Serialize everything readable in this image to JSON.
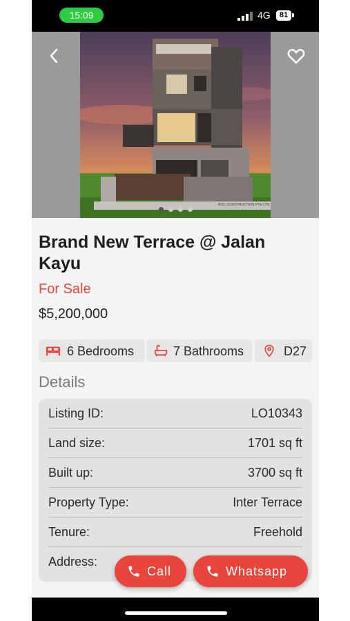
{
  "status_bar": {
    "time": "15:09",
    "network": "4G",
    "battery": "81"
  },
  "listing": {
    "title": "Brand New Terrace @ Jalan Kayu",
    "status": "For Sale",
    "price": "$5,200,000",
    "photo_count": 4,
    "active_photo": 1
  },
  "features": {
    "bedrooms": "6 Bedrooms",
    "bathrooms": "7 Bathrooms",
    "district": "D27"
  },
  "details": {
    "heading": "Details",
    "rows": [
      {
        "label": "Listing ID:",
        "value": "LO10343"
      },
      {
        "label": "Land size:",
        "value": "1701 sq ft"
      },
      {
        "label": "Built up:",
        "value": "3700 sq ft"
      },
      {
        "label": "Property Type:",
        "value": "Inter Terrace"
      },
      {
        "label": "Tenure:",
        "value": "Freehold"
      },
      {
        "label": "Address:",
        "value": ""
      }
    ]
  },
  "actions": {
    "call_label": "Call",
    "whatsapp_label": "Whatsapp"
  },
  "icons": {
    "back": "chevron-left-icon",
    "favorite": "heart-outline-icon",
    "bed": "bed-icon",
    "bath": "bathtub-icon",
    "location": "location-pin-icon",
    "phone": "phone-icon"
  },
  "colors": {
    "accent": "#e8453c",
    "time_pill": "#2ecc40",
    "card": "#e2e2e2"
  }
}
